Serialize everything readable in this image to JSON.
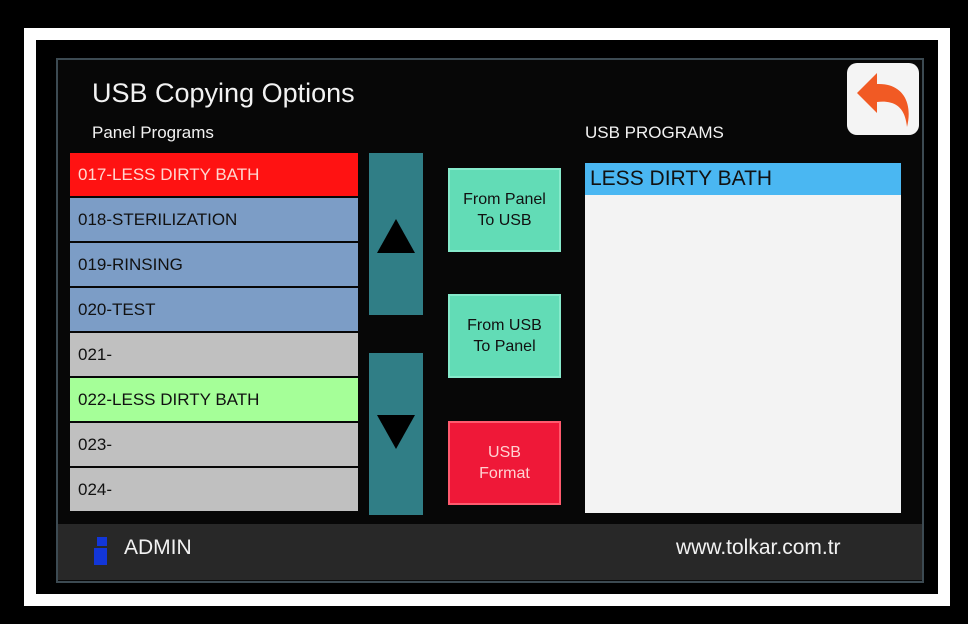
{
  "header": {
    "title": "USB Copying Options",
    "panel_label": "Panel Programs",
    "usb_label": "USB PROGRAMS"
  },
  "back_button": {
    "icon": "back-arrow-icon",
    "color": "#f15a24"
  },
  "panel_programs": [
    {
      "label": "017-LESS DIRTY BATH",
      "state": "red"
    },
    {
      "label": "018-STERILIZATION",
      "state": "blue"
    },
    {
      "label": "019-RINSING",
      "state": "blue"
    },
    {
      "label": "020-TEST",
      "state": "blue"
    },
    {
      "label": "021-",
      "state": "gray"
    },
    {
      "label": "022-LESS DIRTY BATH",
      "state": "green"
    },
    {
      "label": "023-",
      "state": "gray"
    },
    {
      "label": "024-",
      "state": "gray"
    }
  ],
  "scroll": {
    "up_icon": "arrow-up-icon",
    "down_icon": "arrow-down-icon"
  },
  "actions": {
    "panel_to_usb": "From Panel\nTo USB",
    "usb_to_panel": "From USB\nTo Panel",
    "usb_format": "USB\nFormat"
  },
  "usb_programs": [
    {
      "label": "LESS DIRTY BATH",
      "selected": true
    }
  ],
  "footer": {
    "user_icon": "user-icon",
    "user": "ADMIN",
    "website": "www.tolkar.com.tr"
  },
  "colors": {
    "selected_red": "#ff1212",
    "program_blue": "#7c9dc6",
    "program_gray": "#c0c0c0",
    "program_green": "#a5ff98",
    "scroll_teal": "#307e86",
    "action_teal": "#62dcb6",
    "action_red": "#ef1838",
    "usb_selected": "#4ab7f2"
  }
}
